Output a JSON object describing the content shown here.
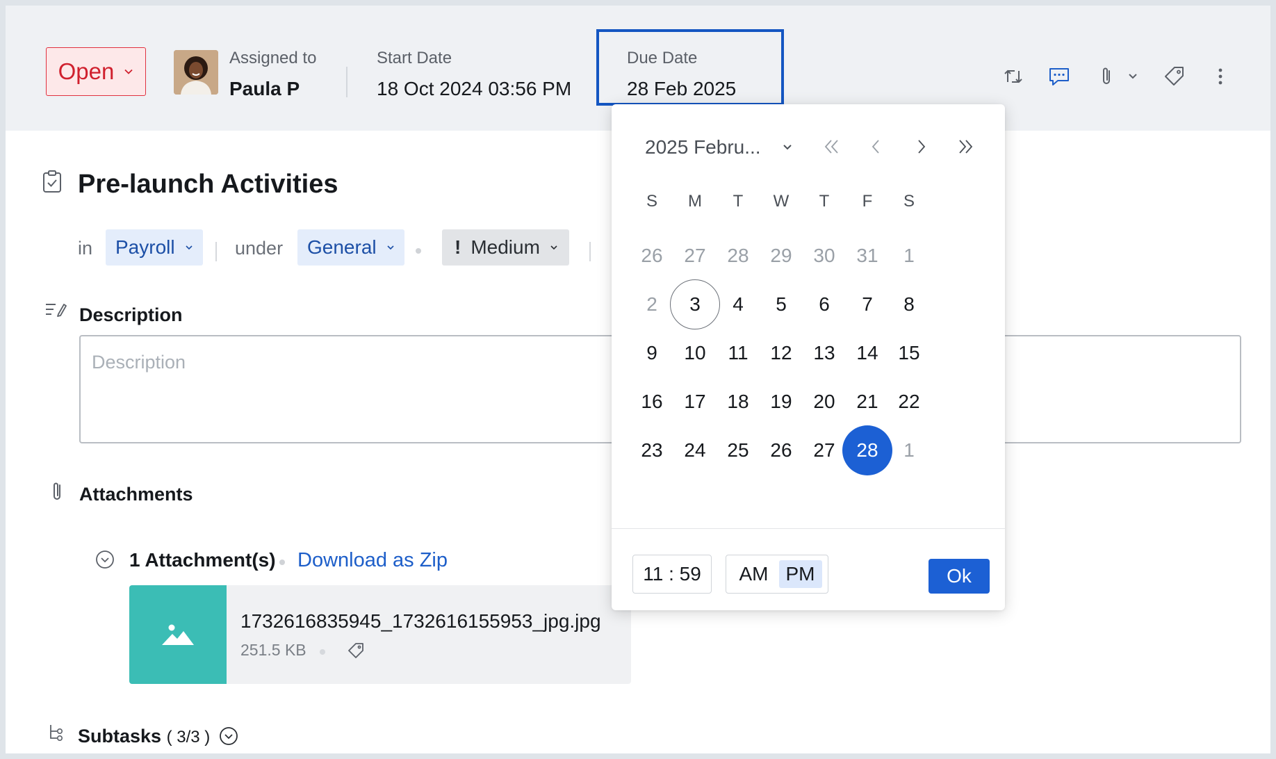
{
  "header": {
    "status": "Open",
    "assignee": {
      "label": "Assigned to",
      "name": "Paula P"
    },
    "start_date": {
      "label": "Start Date",
      "value": "18 Oct 2024 03:56 PM"
    },
    "due_date": {
      "label": "Due Date",
      "value": "28 Feb 2025"
    },
    "toolbar_icons": [
      "repeat-icon",
      "comment-icon",
      "attachment-icon",
      "chevron-down-icon",
      "tag-icon",
      "more-vertical-icon"
    ]
  },
  "task": {
    "title": "Pre-launch Activities",
    "in_label": "in",
    "project": "Payroll",
    "under_label": "under",
    "category": "General",
    "priority_mark": "!",
    "priority": "Medium"
  },
  "description": {
    "title": "Description",
    "placeholder": "Description"
  },
  "attachments": {
    "title": "Attachments",
    "count_label": "1 Attachment(s)",
    "download_label": "Download as Zip",
    "files": [
      {
        "name": "1732616835945_1732616155953_jpg.jpg",
        "size": "251.5 KB"
      }
    ]
  },
  "subtasks": {
    "title": "Subtasks",
    "count": "( 3/3 )"
  },
  "calendar": {
    "month_label": "2025 Febru...",
    "weekdays": [
      "S",
      "M",
      "T",
      "W",
      "T",
      "F",
      "S"
    ],
    "weeks": [
      [
        {
          "d": "26",
          "muted": true
        },
        {
          "d": "27",
          "muted": true
        },
        {
          "d": "28",
          "muted": true
        },
        {
          "d": "29",
          "muted": true
        },
        {
          "d": "30",
          "muted": true
        },
        {
          "d": "31",
          "muted": true
        },
        {
          "d": "1",
          "muted": true
        }
      ],
      [
        {
          "d": "2",
          "muted": true
        },
        {
          "d": "3",
          "today": true
        },
        {
          "d": "4"
        },
        {
          "d": "5"
        },
        {
          "d": "6"
        },
        {
          "d": "7"
        },
        {
          "d": "8"
        }
      ],
      [
        {
          "d": "9"
        },
        {
          "d": "10"
        },
        {
          "d": "11"
        },
        {
          "d": "12"
        },
        {
          "d": "13"
        },
        {
          "d": "14"
        },
        {
          "d": "15"
        }
      ],
      [
        {
          "d": "16"
        },
        {
          "d": "17"
        },
        {
          "d": "18"
        },
        {
          "d": "19"
        },
        {
          "d": "20"
        },
        {
          "d": "21"
        },
        {
          "d": "22"
        }
      ],
      [
        {
          "d": "23"
        },
        {
          "d": "24"
        },
        {
          "d": "25"
        },
        {
          "d": "26"
        },
        {
          "d": "27"
        },
        {
          "d": "28",
          "selected": true
        },
        {
          "d": "1",
          "muted": true
        }
      ]
    ],
    "time": "11 : 59",
    "am_label": "AM",
    "pm_label": "PM",
    "meridiem_selected": "PM",
    "ok_label": "Ok"
  },
  "colors": {
    "accent": "#1c60d4",
    "status_red": "#d0202e",
    "thumb_teal": "#3bbdb5",
    "link_blue": "#1d5ec9"
  }
}
